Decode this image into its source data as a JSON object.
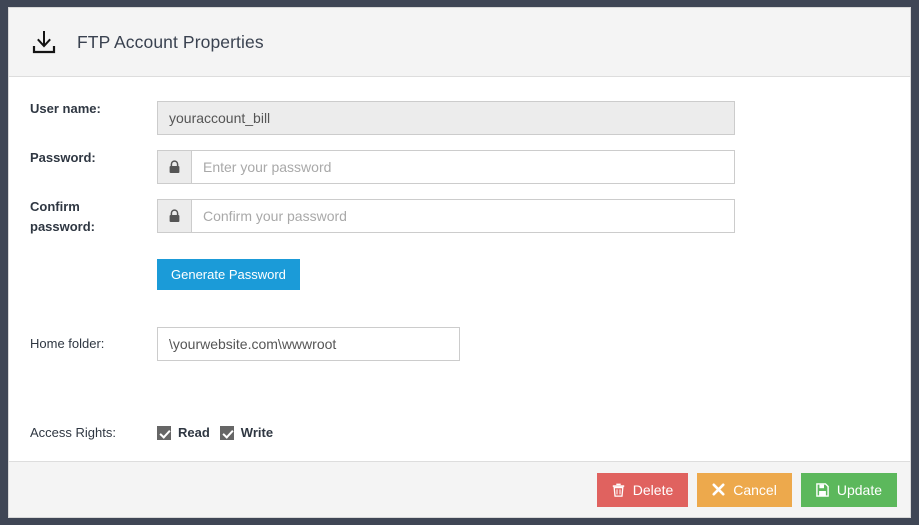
{
  "header": {
    "title": "FTP Account Properties",
    "icon": "download-icon"
  },
  "form": {
    "username": {
      "label": "User name:",
      "value": "youraccount_bill"
    },
    "password": {
      "label": "Password:",
      "placeholder": "Enter your password",
      "value": "",
      "addon_icon": "lock-icon"
    },
    "confirm_password": {
      "label": "Confirm password:",
      "label_line1": "Confirm",
      "label_line2": "password:",
      "placeholder": "Confirm your password",
      "value": "",
      "addon_icon": "lock-icon"
    },
    "generate_password_button": {
      "label": "Generate Password",
      "color": "#1b9bd8"
    },
    "home_folder": {
      "label": "Home folder:",
      "value": "\\yourwebsite.com\\wwwroot"
    },
    "access_rights": {
      "label": "Access Rights:",
      "options": [
        {
          "label": "Read",
          "checked": true
        },
        {
          "label": "Write",
          "checked": true
        }
      ]
    }
  },
  "footer": {
    "buttons": [
      {
        "label": "Delete",
        "icon": "trash-icon",
        "color": "#e0625f"
      },
      {
        "label": "Cancel",
        "icon": "close-x-icon",
        "color": "#eda94c"
      },
      {
        "label": "Update",
        "icon": "save-floppy-icon",
        "color": "#5cb85c"
      }
    ]
  }
}
